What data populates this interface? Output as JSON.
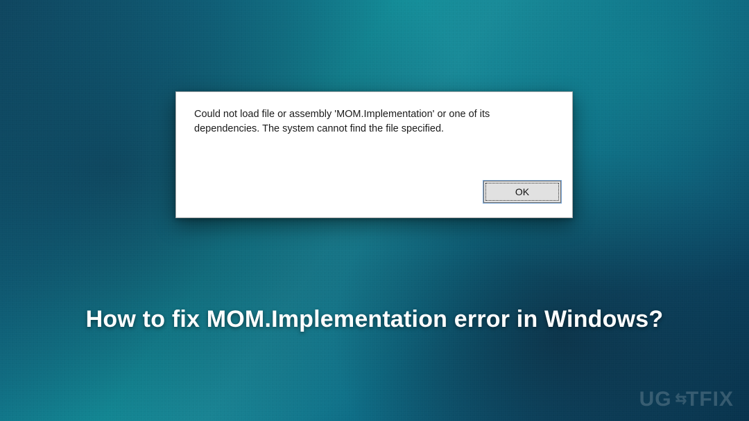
{
  "dialog": {
    "message": "Could not load file or assembly 'MOM.Implementation' or one of its dependencies. The system cannot find the file specified.",
    "ok_label": "OK"
  },
  "headline": "How to fix MOM.Implementation error in Windows?",
  "watermark": {
    "left": "UG",
    "mid": "⇆",
    "right": "TFIX"
  }
}
